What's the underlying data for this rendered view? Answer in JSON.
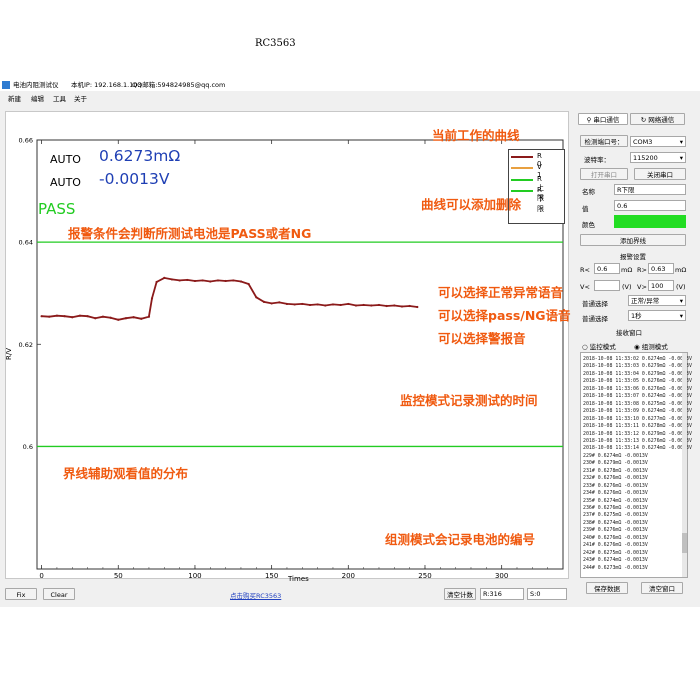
{
  "window": {
    "title": "电池内阻测试仪",
    "ip": "本机IP: 192.168.1.103",
    "qq": "QQ邮箱:594824985@qq.com"
  },
  "menu": [
    "新建",
    "编辑",
    "工具",
    "关于"
  ],
  "chart_data": {
    "type": "line",
    "title": "RC3563",
    "xlabel": "Times",
    "ylabel": "R/V",
    "xlim": [
      -3,
      340
    ],
    "ylim": [
      0.576,
      0.66
    ],
    "x_ticks": [
      "0",
      "50",
      "100",
      "150",
      "200",
      "250",
      "300"
    ],
    "y_ticks": [
      "0.66",
      "0.64",
      "0.62",
      "0.6"
    ],
    "upper_limit": 0.64,
    "lower_limit": 0.6,
    "series": [
      {
        "name": "R 0",
        "color": "#8b1a1a",
        "x": [
          0,
          5,
          10,
          15,
          20,
          25,
          30,
          35,
          40,
          45,
          50,
          55,
          60,
          65,
          70,
          72,
          75,
          80,
          85,
          90,
          95,
          100,
          105,
          110,
          115,
          120,
          125,
          130,
          135,
          140,
          145,
          150,
          155,
          160,
          165,
          170,
          175,
          180,
          185,
          190,
          195,
          200,
          205,
          210,
          215,
          220,
          225,
          230,
          235,
          240,
          245
        ],
        "y": [
          0.6255,
          0.6254,
          0.6256,
          0.6255,
          0.6253,
          0.6256,
          0.6255,
          0.6251,
          0.6254,
          0.6252,
          0.6248,
          0.6251,
          0.6253,
          0.625,
          0.6254,
          0.629,
          0.6322,
          0.633,
          0.6327,
          0.6325,
          0.6326,
          0.6324,
          0.6325,
          0.6323,
          0.6325,
          0.6324,
          0.6325,
          0.6323,
          0.6318,
          0.6292,
          0.6283,
          0.628,
          0.6282,
          0.6279,
          0.6278,
          0.6279,
          0.6277,
          0.6278,
          0.6276,
          0.6278,
          0.6277,
          0.6279,
          0.6276,
          0.6277,
          0.6276,
          0.6277,
          0.6275,
          0.6276,
          0.6274,
          0.6275,
          0.6273
        ]
      },
      {
        "name": "V 1",
        "color": "#e8a040",
        "x": [],
        "y": []
      },
      {
        "name": "R上限",
        "color": "#22cc22"
      },
      {
        "name": "R下限",
        "color": "#22cc22"
      }
    ]
  },
  "readout": {
    "mode1": "AUTO",
    "mode2": "AUTO",
    "resistance": "0.6273mΩ",
    "voltage": "-0.0013V",
    "result": "PASS"
  },
  "annotations": [
    "当前工作的曲线",
    "曲线可以添加删除",
    "报警条件会判断所测试电池是PASS或者NG",
    "可以选择正常异常语音",
    "可以选择pass/NG语音",
    "可以选择警报音",
    "监控模式记录测试的时间",
    "界线辅助观看值的分布",
    "组测模式会记录电池的编号"
  ],
  "bottom": {
    "fix": "Fix",
    "clear": "Clear",
    "link": "点击购买RC3563",
    "reset_count": "清空计数",
    "r_count": "R:316",
    "s_count": "S:0"
  },
  "panel": {
    "tab_serial": "串口通信",
    "tab_network": "网络通信",
    "port_label": "检测端口号：",
    "port_value": "COM3",
    "baud_label": "波特率：",
    "baud_value": "115200",
    "open_port": "打开串口",
    "close_port": "关闭串口",
    "name_label": "名称",
    "name_value": "R下限",
    "value_label": "值",
    "value_value": "0.6",
    "color_label": "颜色",
    "color_value": "#22dd22",
    "add_line": "添加界线",
    "alarm_settings": "报警设置",
    "r_lt": "R<",
    "r_lt_value": "0.6",
    "r_gt": "R>",
    "r_gt_value": "0.63",
    "ohm_unit": "mΩ",
    "v_lt": "V<",
    "v_lt_value": "",
    "v_gt": "V>",
    "v_gt_value": "100",
    "v_unit": "(V)",
    "voice_label": "普通选择",
    "voice_value": "正常/异常",
    "interval_label": "普通选择",
    "interval_value": "1秒",
    "receive_window": "接收窗口",
    "mode_monitor": "监控模式",
    "mode_group": "组测模式",
    "save_data": "保存数据",
    "clear_window": "清空窗口"
  },
  "log_monitor": [
    "2018-10-08 11:33:02 0.6274mΩ -0.0013V",
    "2018-10-08 11:33:03 0.6279mΩ -0.0013V",
    "2018-10-08 11:33:04 0.6279mΩ -0.0013V",
    "2018-10-08 11:33:05 0.6276mΩ -0.0013V",
    "2018-10-08 11:33:06 0.6276mΩ -0.0013V",
    "2018-10-08 11:33:07 0.6274mΩ -0.0013V",
    "2018-10-08 11:33:08 0.6275mΩ -0.0013V",
    "2018-10-08 11:33:09 0.6274mΩ -0.0013V",
    "2018-10-08 11:33:10 0.6277mΩ -0.0013V",
    "2018-10-08 11:33:11 0.6278mΩ -0.0013V",
    "2018-10-08 11:33:12 0.6279mΩ -0.0013V",
    "2018-10-08 11:33:13 0.6276mΩ -0.0013V",
    "2018-10-08 11:33:14 0.6274mΩ -0.0013V"
  ],
  "log_group": [
    "229# 0.6274mΩ -0.0013V",
    "230# 0.6279mΩ -0.0013V",
    "231# 0.6278mΩ -0.0013V",
    "232# 0.6276mΩ -0.0013V",
    "233# 0.6276mΩ -0.0013V",
    "234# 0.6276mΩ -0.0013V",
    "235# 0.6274mΩ -0.0013V",
    "236# 0.6276mΩ -0.0013V",
    "237# 0.6275mΩ -0.0013V",
    "238# 0.6274mΩ -0.0013V",
    "239# 0.6276mΩ -0.0013V",
    "240# 0.6276mΩ -0.0013V",
    "241# 0.6276mΩ -0.0013V",
    "242# 0.6275mΩ -0.0013V",
    "243# 0.6274mΩ -0.0013V",
    "244# 0.6273mΩ -0.0013V"
  ]
}
